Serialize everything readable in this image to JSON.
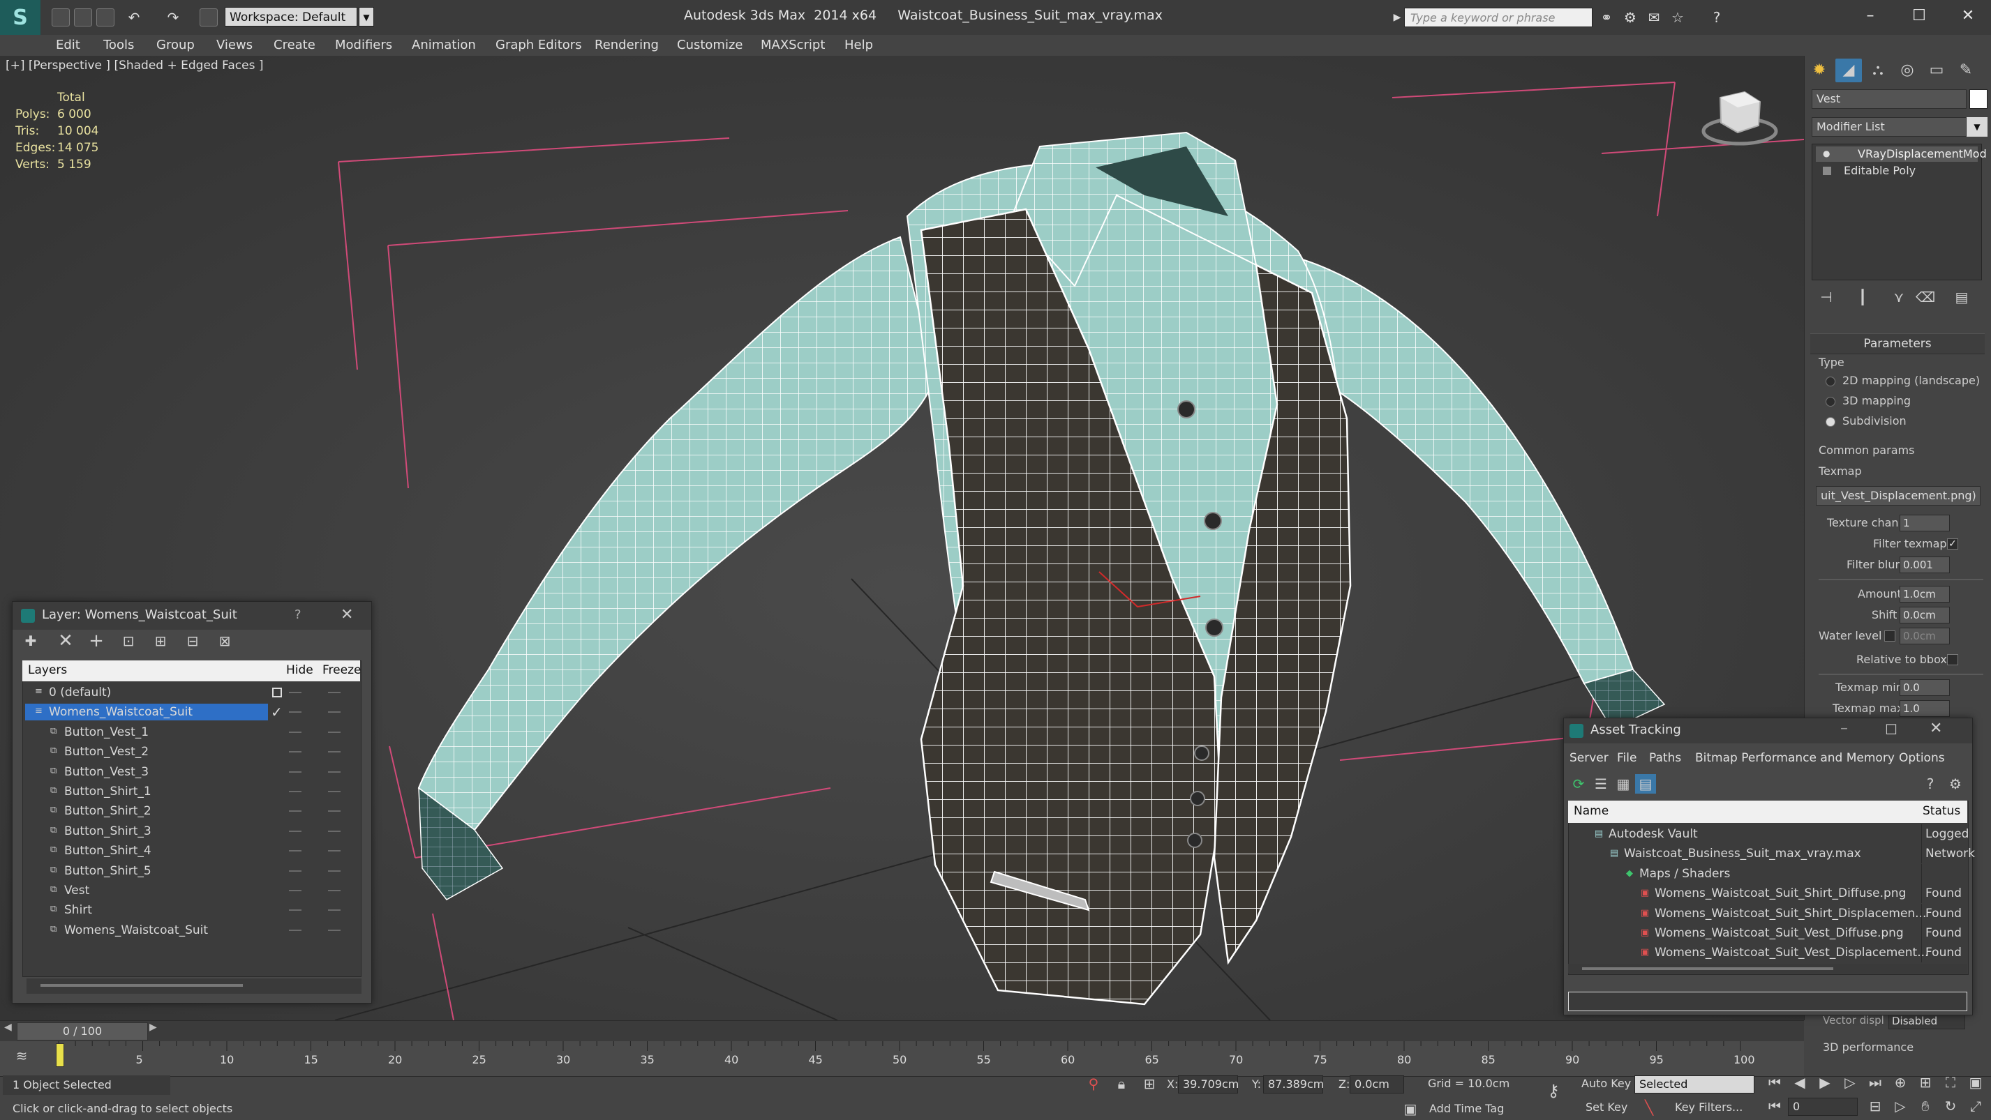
{
  "app": {
    "logo": "S",
    "workspace": "Workspace: Default",
    "title": "Autodesk 3ds Max  2014 x64     Waistcoat_Business_Suit_max_vray.max",
    "search_placeholder": "Type a keyword or phrase"
  },
  "menu": [
    "Edit",
    "Tools",
    "Group",
    "Views",
    "Create",
    "Modifiers",
    "Animation",
    "Graph Editors",
    "Rendering",
    "Customize",
    "MAXScript",
    "Help"
  ],
  "viewport": {
    "label": "[+] [Perspective ] [Shaded + Edged Faces ]",
    "stats": {
      "header": "Total",
      "rows": [
        {
          "label": "Polys:",
          "value": "6 000"
        },
        {
          "label": "Tris:",
          "value": "10 004"
        },
        {
          "label": "Edges:",
          "value": "14 075"
        },
        {
          "label": "Verts:",
          "value": "5 159"
        }
      ]
    }
  },
  "command_panel": {
    "object_name": "Vest",
    "modifier_list": "Modifier List",
    "stack": [
      "VRayDisplacementMod",
      "Editable Poly"
    ],
    "parameters_title": "Parameters",
    "type_label": "Type",
    "type_options": [
      "2D mapping (landscape)",
      "3D mapping",
      "Subdivision"
    ],
    "common_params": "Common params",
    "texmap_label": "Texmap",
    "texmap_value": "uit_Vest_Displacement.png)",
    "texture_chan_label": "Texture chan",
    "texture_chan_value": "1",
    "filter_texmap_label": "Filter texmap",
    "filter_blur_label": "Filter blur",
    "filter_blur_value": "0.001",
    "amount_label": "Amount",
    "amount_value": "1.0cm",
    "shift_label": "Shift",
    "shift_value": "0.0cm",
    "water_level_label": "Water level",
    "water_level_value": "0.0cm",
    "relative_to_bbox": "Relative to bbox",
    "texmap_min_label": "Texmap min",
    "texmap_min_value": "0.0",
    "texmap_max_label": "Texmap max",
    "texmap_max_value": "1.0",
    "vector_disp_label": "Vector displ",
    "vector_disp_value": "Disabled",
    "perf_label": "3D performance"
  },
  "layer_window": {
    "title": "Layer: Womens_Waistcoat_Suit",
    "help": "?",
    "columns": {
      "layers": "Layers",
      "hide": "Hide",
      "freeze": "Freeze"
    },
    "rows": [
      {
        "name": "0 (default)",
        "level": 0
      },
      {
        "name": "Womens_Waistcoat_Suit",
        "level": 0
      },
      {
        "name": "Button_Vest_1",
        "level": 1
      },
      {
        "name": "Button_Vest_2",
        "level": 1
      },
      {
        "name": "Button_Vest_3",
        "level": 1
      },
      {
        "name": "Button_Shirt_1",
        "level": 1
      },
      {
        "name": "Button_Shirt_2",
        "level": 1
      },
      {
        "name": "Button_Shirt_3",
        "level": 1
      },
      {
        "name": "Button_Shirt_4",
        "level": 1
      },
      {
        "name": "Button_Shirt_5",
        "level": 1
      },
      {
        "name": "Vest",
        "level": 1
      },
      {
        "name": "Shirt",
        "level": 1
      },
      {
        "name": "Womens_Waistcoat_Suit",
        "level": 1
      }
    ]
  },
  "asset_window": {
    "title": "Asset Tracking",
    "menu": [
      "Server",
      "File",
      "Paths",
      "Bitmap Performance and Memory",
      "Options"
    ],
    "columns": {
      "name": "Name",
      "status": "Status"
    },
    "rows": [
      {
        "name": "Autodesk Vault",
        "status": "Logged",
        "indent": 1
      },
      {
        "name": "Waistcoat_Business_Suit_max_vray.max",
        "status": "Network",
        "indent": 2
      },
      {
        "name": "Maps / Shaders",
        "status": "",
        "indent": 3
      },
      {
        "name": "Womens_Waistcoat_Suit_Shirt_Diffuse.png",
        "status": "Found",
        "indent": 4
      },
      {
        "name": "Womens_Waistcoat_Suit_Shirt_Displacemen...",
        "status": "Found",
        "indent": 4
      },
      {
        "name": "Womens_Waistcoat_Suit_Vest_Diffuse.png",
        "status": "Found",
        "indent": 4
      },
      {
        "name": "Womens_Waistcoat_Suit_Vest_Displacement...",
        "status": "Found",
        "indent": 4
      }
    ]
  },
  "timeline": {
    "frame": "0 / 100",
    "ticks": [
      "5",
      "10",
      "15",
      "20",
      "25",
      "30",
      "35",
      "40",
      "45",
      "50",
      "55",
      "60",
      "65",
      "70",
      "75",
      "80",
      "85",
      "90",
      "95",
      "100"
    ]
  },
  "status": {
    "selected": "1 Object Selected",
    "prompt": "Click or click-and-drag to select objects",
    "x_label": "X:",
    "x_value": "39.709cm",
    "y_label": "Y:",
    "y_value": "87.389cm",
    "z_label": "Z:",
    "z_value": "0.0cm",
    "grid": "Grid = 10.0cm",
    "add_time_tag": "Add Time Tag",
    "auto_key": "Auto Key",
    "set_key": "Set Key",
    "selected_dropdown": "Selected",
    "key_filters": "Key Filters...",
    "frame_value": "0"
  },
  "colors": {
    "accent": "#1e5c5a",
    "selection": "#2e6fc6",
    "shirt": "#9fcfc8",
    "vest": "#3a3630",
    "wire": "#ffffff",
    "grid_pink": "#d04a78"
  }
}
